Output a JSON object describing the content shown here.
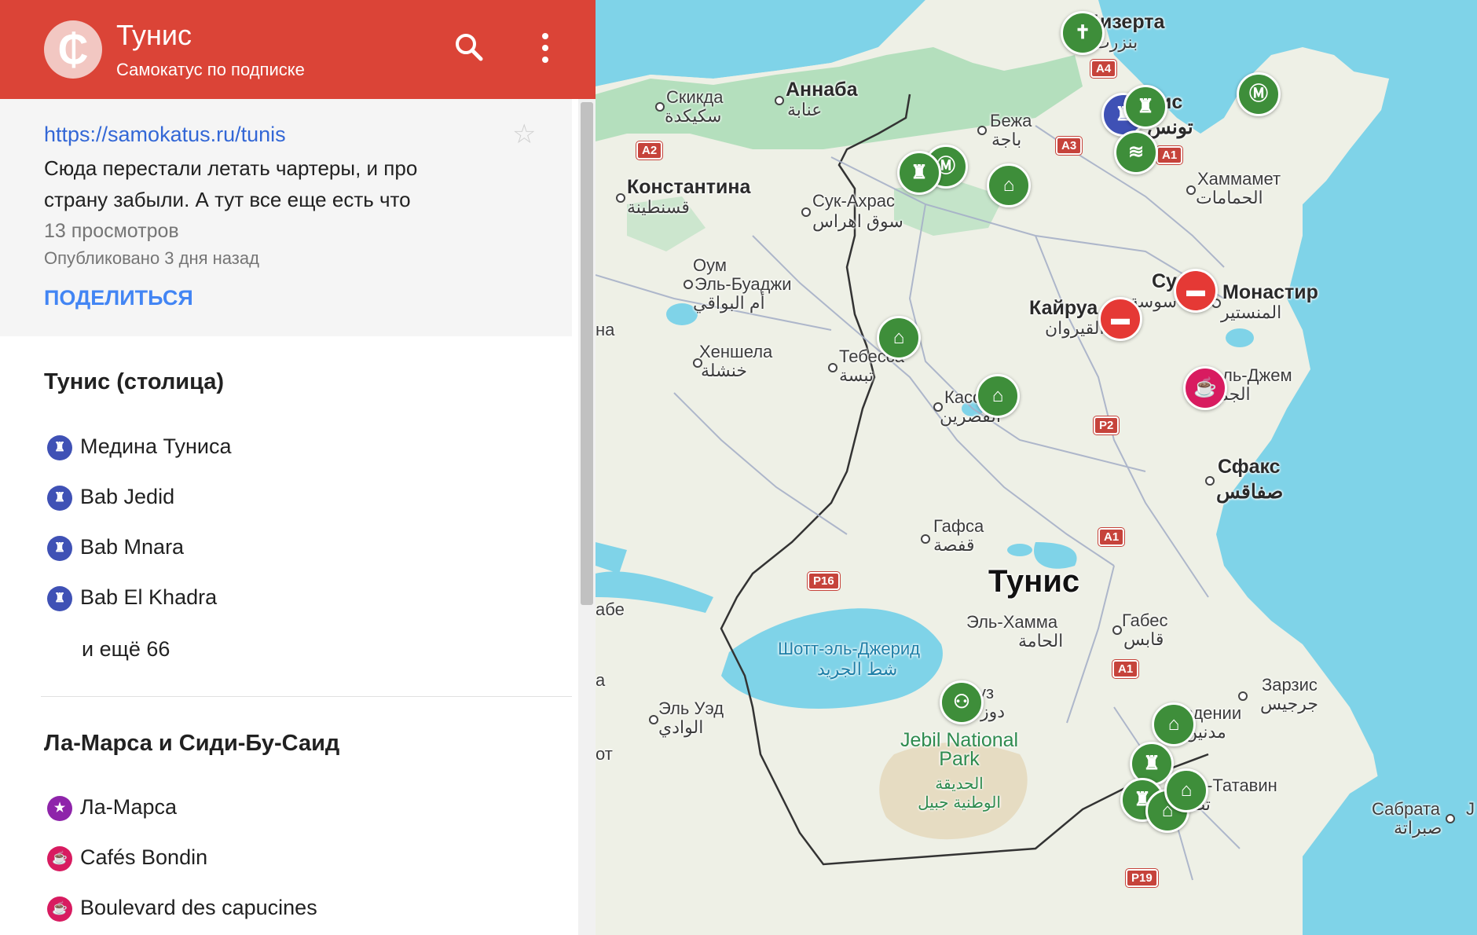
{
  "header": {
    "title": "Тунис",
    "subtitle": "Самокатус по подписке",
    "logo_glyph": "₵",
    "search_icon": "search-icon",
    "menu_icon": "more-vert-icon",
    "color": "#db4437"
  },
  "info": {
    "url": "https://samokatus.ru/tunis",
    "description": "Сюда перестали летать чартеры, и про страну забыли. А тут все еще есть что",
    "views": "13 просмотров",
    "published": "Опубликовано 3 дня назад",
    "share_label": "ПОДЕЛИТЬСЯ",
    "star_icon": "star-outline-icon"
  },
  "sections": [
    {
      "title": "Тунис (столица)",
      "items": [
        {
          "label": "Медина Туниса",
          "icon": "castle-icon",
          "color": "#3f51b5"
        },
        {
          "label": "Bab Jedid",
          "icon": "castle-icon",
          "color": "#3f51b5"
        },
        {
          "label": "Bab Mnara",
          "icon": "castle-icon",
          "color": "#3f51b5"
        },
        {
          "label": "Bab El Khadra",
          "icon": "castle-icon",
          "color": "#3f51b5"
        }
      ],
      "more": "и ещё 66"
    },
    {
      "title": "Ла-Марса и Сиди-Бу-Саид",
      "items": [
        {
          "label": "Ла-Марса",
          "icon": "star-icon",
          "color": "#8e24aa"
        },
        {
          "label": "Cafés Bondin",
          "icon": "coffee-icon",
          "color": "#d81b60"
        },
        {
          "label": "Boulevard des capucines",
          "icon": "coffee-icon",
          "color": "#d81b60"
        }
      ]
    }
  ],
  "map": {
    "country_label": "Тунис",
    "labels": {
      "bizerte_ru": "Бизерта",
      "bizerte_ar": "بنزرت",
      "skikda_ru": "Скикда",
      "skikda_ar": "سكيكدة",
      "annaba_ru": "Аннаба",
      "annaba_ar": "عنابة",
      "beja_ru": "Бежа",
      "beja_ar": "باجة",
      "tunis_ru": "ис",
      "tunis_ar": "تونس",
      "constantine_ru": "Константина",
      "constantine_ar": "قسنطينة",
      "soukahras_ru": "Сук-Ахрас",
      "soukahras_ar": "سوق اهراس",
      "hammamet_ru": "Хаммамет",
      "hammamet_ar": "الحمامات",
      "oum_ru1": "Оум",
      "oum_ru2": "Эль-Буаджи",
      "oum_ar": "أم البواقي",
      "kairouan_ru": "Кайруа",
      "kairouan_ar": "القيروان",
      "sousse_ru": "Су",
      "sousse_ar": "سوسة",
      "monastir_ru": "Монастир",
      "monastir_ar": "المنستير",
      "khenchela_ru": "Хеншела",
      "khenchela_ar": "خنشلة",
      "tebessa_ru": "Тебесса",
      "tebessa_ar": "تبسة",
      "kasserine_ru": "Кассерин",
      "kasserine_ar": "القصرين",
      "eljem_ru": "ль-Джем",
      "eljem_ar": "الجم",
      "sfax_ru": "Сфакс",
      "sfax_ar": "صفاقس",
      "gafsa_ru": "Гафса",
      "gafsa_ar": "قفصة",
      "elhamma_ru": "Эль-Хамма",
      "elhamma_ar": "الحامة",
      "gabes_ru": "Габес",
      "gabes_ar": "قابس",
      "chott_ru": "Шотт-эль-Джерид",
      "chott_ar": "شط الجريد",
      "douz_ru": "уз",
      "douz_ar": "دوز",
      "zarzis_ru": "Зарзис",
      "zarzis_ar": "جرجيس",
      "medenine_ru": "Медении",
      "medenine_ar": "مدنين",
      "park_line1": "Jebil National",
      "park_line2": "Park",
      "park_ar1": "الحديقة",
      "park_ar2": "الوطنية جبيل",
      "eloued_ru": "Эль Уэд",
      "eloued_ar": "الوادي",
      "tataouine_ru": "Тум-Татавин",
      "tataouine_ar": "تطا",
      "sabratha_ru": "Сабрата",
      "sabratha_ar": "صبراتة",
      "edge_na": "на",
      "edge_abe": "абе",
      "edge_a": "а",
      "edge_t": "от",
      "edge_j": "J"
    },
    "roads": [
      "A4",
      "A2",
      "A3",
      "A1",
      "P2",
      "A1",
      "P16",
      "A1",
      "P19"
    ],
    "colors": {
      "water": "#7fd3e8",
      "land": "#eef0e6",
      "forest": "#a9dcb5",
      "green_pin": "#3e8e3a",
      "blue_pin": "#3f51b5",
      "red_pin": "#e53935"
    }
  }
}
